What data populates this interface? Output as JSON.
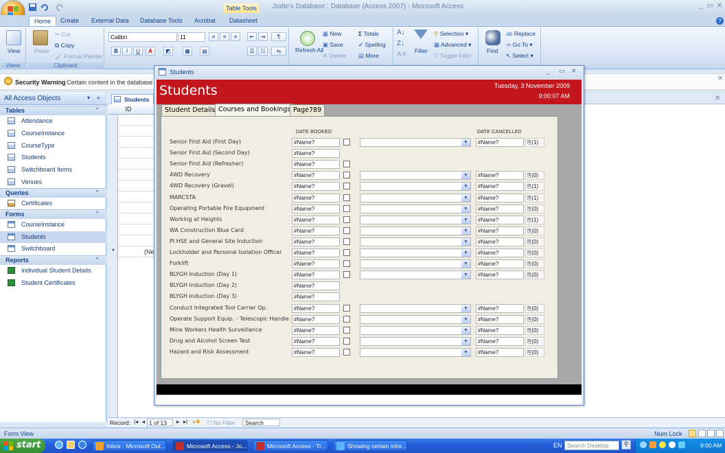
{
  "window": {
    "title": "Jodie's Database : Database (Access 2007) - Microsoft Access",
    "context_tab": "Table Tools",
    "controls": {
      "minimize": "_",
      "restore": "▭",
      "close": "✕"
    }
  },
  "ribbon_tabs": [
    "Home",
    "Create",
    "External Data",
    "Database Tools",
    "Acrobat",
    "Datasheet"
  ],
  "ribbon": {
    "views": {
      "view": "View",
      "label": "Views"
    },
    "clipboard": {
      "paste": "Paste",
      "cut": "Cut",
      "copy": "Copy",
      "format_painter": "Format Painter",
      "label": "Clipboard"
    },
    "font": {
      "name": "Calibri",
      "size": "11"
    },
    "records": {
      "refresh": "Refresh All",
      "new": "New",
      "save": "Save",
      "delete": "Delete",
      "totals": "Totals",
      "spelling": "Spelling",
      "more": "More"
    },
    "sort_filter": {
      "filter": "Filter",
      "selection": "Selection",
      "advanced": "Advanced",
      "toggle_filter": "Toggle Filter"
    },
    "find": {
      "find": "Find",
      "replace": "Replace",
      "go_to": "Go To",
      "select": "Select"
    }
  },
  "security": {
    "bold": "Security Warning",
    "text": "Certain content in the database h"
  },
  "nav": {
    "header": "All Access Objects",
    "groups": [
      {
        "name": "Tables",
        "items": [
          "Attendance",
          "CourseInstance",
          "CourseType",
          "Students",
          "Switchboard Items",
          "Venues"
        ]
      },
      {
        "name": "Queries",
        "items": [
          "Certificates"
        ]
      },
      {
        "name": "Forms",
        "items": [
          "CourseInstance",
          "Students",
          "Switchboard"
        ]
      },
      {
        "name": "Reports",
        "items": [
          "Individual Student Details",
          "Student Certificates"
        ]
      }
    ]
  },
  "datasheet": {
    "tab": "Students",
    "col_id": "ID",
    "new_row_marker": "*",
    "new_row_value": "(Ne"
  },
  "record_bar": {
    "label": "Record:",
    "current": "1 of 13",
    "no_filter": "No Filter",
    "search": "Search"
  },
  "status": {
    "left": "Form View",
    "right": "Num Lock"
  },
  "form": {
    "window_title": "Students",
    "heading": "Students",
    "date": "Tuesday, 3 November 2009",
    "time": "9:00:07 AM",
    "tabs": [
      "Student Details",
      "Courses and Bookings",
      "Page789"
    ],
    "col_booked": "DATE BOOKED",
    "col_cancelled": "DATE CANCELLED",
    "courses": [
      {
        "name": "Senior First Aid (First Day)",
        "booked": "#Name?",
        "check": true,
        "combo": true,
        "cancelled": "#Name?",
        "att": "(1)"
      },
      {
        "name": "Senior First Aid (Second Day)",
        "booked": "#Name?",
        "check": false,
        "combo": false,
        "cancelled": null,
        "att": null
      },
      {
        "name": "Senior First Aid (Refresher)",
        "booked": "#Name?",
        "check": true,
        "combo": false,
        "cancelled": null,
        "att": null
      },
      {
        "name": "4WD Recovery",
        "booked": "#Name?",
        "check": true,
        "combo": true,
        "cancelled": "#Name?",
        "att": "(0)"
      },
      {
        "name": "4WD Recovery (Gravel)",
        "booked": "#Name?",
        "check": true,
        "combo": true,
        "cancelled": "#Name?",
        "att": "(1)"
      },
      {
        "name": "MARCSTA",
        "booked": "#Name?",
        "check": true,
        "combo": true,
        "cancelled": "#Name?",
        "att": "(1)"
      },
      {
        "name": "Operating Portable Fire Equipment",
        "booked": "#Name?",
        "check": true,
        "combo": true,
        "cancelled": "#Name?",
        "att": "(0)"
      },
      {
        "name": "Working at Heights",
        "booked": "#Name?",
        "check": true,
        "combo": true,
        "cancelled": "#Name?",
        "att": "(1)"
      },
      {
        "name": "WA Construction Blue Card",
        "booked": "#Name?",
        "check": true,
        "combo": true,
        "cancelled": "#Name?",
        "att": "(0)"
      },
      {
        "name": "PI HSE and General Site Induction",
        "booked": "#Name?",
        "check": true,
        "combo": true,
        "cancelled": "#Name?",
        "att": "(0)"
      },
      {
        "name": "Lockholder and Personal Isolation Officer",
        "booked": "#Name?",
        "check": true,
        "combo": true,
        "cancelled": "#Name?",
        "att": "(0)"
      },
      {
        "name": "Forklift",
        "booked": "#Name?",
        "check": true,
        "combo": true,
        "cancelled": "#Name?",
        "att": "(0)"
      },
      {
        "name": "BLYGH Induction (Day 1)",
        "booked": "#Name?",
        "check": true,
        "combo": true,
        "cancelled": "#Name?",
        "att": "(0)"
      },
      {
        "name": "BLYGH Induction (Day 2)",
        "booked": "#Name?",
        "check": false,
        "combo": false,
        "cancelled": null,
        "att": null
      },
      {
        "name": "BLYGH Induction (Day 3)",
        "booked": "#Name?",
        "check": false,
        "combo": false,
        "cancelled": null,
        "att": null
      },
      {
        "name": "Conduct Integrated Tool Carrier Op.",
        "booked": "#Name?",
        "check": true,
        "combo": true,
        "cancelled": "#Name?",
        "att": "(0)"
      },
      {
        "name": "Operate Support Equip. - Telescopic Handle",
        "booked": "#Name?",
        "check": true,
        "combo": true,
        "cancelled": "#Name?",
        "att": "(0)"
      },
      {
        "name": "Mine Workers Health Surveillance",
        "booked": "#Name?",
        "check": true,
        "combo": true,
        "cancelled": "#Name?",
        "att": "(0)"
      },
      {
        "name": "Drug and Alcohol Screen Test",
        "booked": "#Name?",
        "check": true,
        "combo": true,
        "cancelled": "#Name?",
        "att": "(0)"
      },
      {
        "name": "Hazard and Risk Assessment",
        "booked": "#Name?",
        "check": true,
        "combo": true,
        "cancelled": "#Name?",
        "att": "(0)"
      }
    ]
  },
  "taskbar": {
    "start": "start",
    "buttons": [
      "Inbox - Microsoft Out...",
      "Microsoft Access - Jo...",
      "Microsoft Access - Tr...",
      "Showing certain infor..."
    ],
    "lang": "EN",
    "search_placeholder": "Search Desktop",
    "clock": "9:00 AM"
  }
}
